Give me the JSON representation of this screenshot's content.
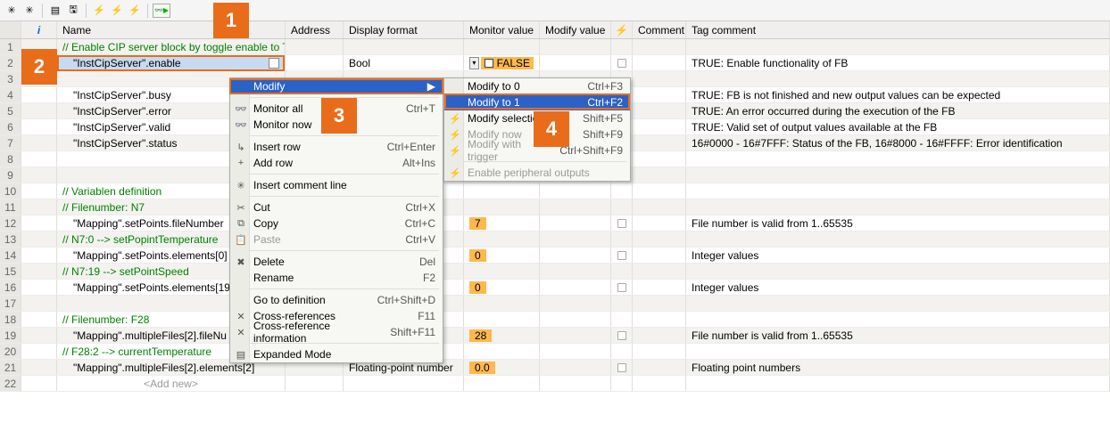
{
  "headers": {
    "i": "i",
    "name": "Name",
    "address": "Address",
    "display_format": "Display format",
    "monitor_value": "Monitor value",
    "modify_value": "Modify value",
    "comment": "Comment",
    "tag_comment": "Tag comment"
  },
  "rows": [
    {
      "n": 1,
      "name": "// Enable CIP server block by toggle enable to TRUE",
      "green": true,
      "alt": true
    },
    {
      "n": 2,
      "name": "\"InstCipServer\".enable",
      "disp": "Bool",
      "mon": "FALSE",
      "mon_false": true,
      "tag": "TRUE: Enable functionality of FB",
      "selected": true
    },
    {
      "n": 3,
      "alt": true
    },
    {
      "n": 4,
      "name": "\"InstCipServer\".busy",
      "tag": "TRUE: FB is not finished and new output values can be expected"
    },
    {
      "n": 5,
      "name": "\"InstCipServer\".error",
      "tag": "TRUE: An error occurred during the execution of the FB",
      "alt": true
    },
    {
      "n": 6,
      "name": "\"InstCipServer\".valid",
      "tag": "TRUE: Valid set of output values available at the FB"
    },
    {
      "n": 7,
      "name": "\"InstCipServer\".status",
      "tag": "16#0000 - 16#7FFF: Status of the FB, 16#8000 - 16#FFFF: Error identification",
      "alt": true
    },
    {
      "n": 8
    },
    {
      "n": 9,
      "alt": true
    },
    {
      "n": 10,
      "name": "// Variablen definition",
      "green": true
    },
    {
      "n": 11,
      "name": "// Filenumber: N7",
      "green": true,
      "alt": true
    },
    {
      "n": 12,
      "name": "\"Mapping\".setPoints.fileNumber",
      "mon": "7",
      "tag": "File number is valid from 1..65535"
    },
    {
      "n": 13,
      "name": "// N7:0 --> setPopintTemperature",
      "green": true,
      "alt": true
    },
    {
      "n": 14,
      "name": "\"Mapping\".setPoints.elements[0]",
      "mon": "0",
      "tag": "Integer values"
    },
    {
      "n": 15,
      "name": "// N7:19 --> setPointSpeed",
      "green": true,
      "alt": true
    },
    {
      "n": 16,
      "name": "\"Mapping\".setPoints.elements[19",
      "mon": "0",
      "tag": "Integer values"
    },
    {
      "n": 17,
      "alt": true
    },
    {
      "n": 18,
      "name": "// Filenumber: F28",
      "green": true
    },
    {
      "n": 19,
      "name": "\"Mapping\".multipleFiles[2].fileNu",
      "mon": "28",
      "tag": "File number is valid from 1..65535",
      "alt": true
    },
    {
      "n": 20,
      "name": "// F28:2 --> currentTemperature",
      "green": true
    },
    {
      "n": 21,
      "name": "\"Mapping\".multipleFiles[2].elements[2]",
      "disp": "Floating-point number",
      "mon": "0.0",
      "tag": "Floating point numbers",
      "alt": true
    },
    {
      "n": 22,
      "addnew": "<Add new>"
    }
  ],
  "context_menu": {
    "modify": "Modify",
    "monitor_all": "Monitor all",
    "monitor_now": "Monitor now",
    "insert_row": "Insert row",
    "add_row": "Add row",
    "insert_comment_line": "Insert comment line",
    "cut": "Cut",
    "copy": "Copy",
    "paste": "Paste",
    "delete": "Delete",
    "rename": "Rename",
    "goto_def": "Go to definition",
    "cross_ref": "Cross-references",
    "cross_ref_info": "Cross-reference information",
    "expanded_mode": "Expanded Mode",
    "sc_monitor_all": "Ctrl+T",
    "sc_insert_row": "Ctrl+Enter",
    "sc_add_row": "Alt+Ins",
    "sc_cut": "Ctrl+X",
    "sc_copy": "Ctrl+C",
    "sc_paste": "Ctrl+V",
    "sc_delete": "Del",
    "sc_rename": "F2",
    "sc_goto": "Ctrl+Shift+D",
    "sc_xref": "F11",
    "sc_xrefi": "Shift+F11"
  },
  "submenu": {
    "modify_to_0": "Modify to 0",
    "modify_to_1": "Modify to 1",
    "modify_sel": "Modify selection",
    "modify_now": "Modify now",
    "modify_with_trigger": "Modify with trigger",
    "enable_periph": "Enable peripheral outputs",
    "sc_0": "Ctrl+F3",
    "sc_1": "Ctrl+F2",
    "sc_sel": "Shift+F5",
    "sc_now": "Shift+F9",
    "sc_trig": "Ctrl+Shift+F9"
  },
  "markers": {
    "m1": "1",
    "m2": "2",
    "m3": "3",
    "m4": "4"
  }
}
